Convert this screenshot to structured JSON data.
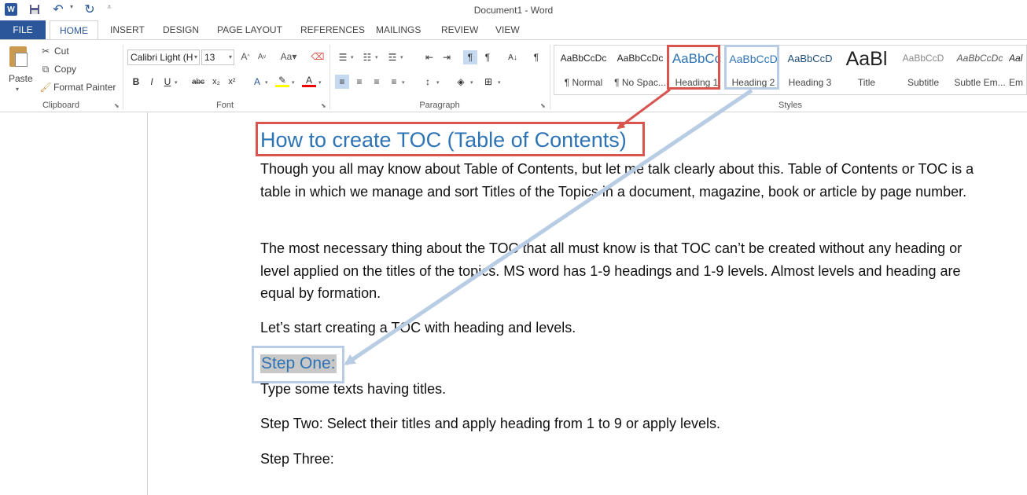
{
  "window": {
    "title": "Document1 - Word"
  },
  "quick_access": {
    "word_logo": "W"
  },
  "tabs": [
    "FILE",
    "HOME",
    "INSERT",
    "DESIGN",
    "PAGE LAYOUT",
    "REFERENCES",
    "MAILINGS",
    "REVIEW",
    "VIEW"
  ],
  "clipboard": {
    "paste": "Paste",
    "cut": "Cut",
    "copy": "Copy",
    "format_painter": "Format Painter",
    "label": "Clipboard"
  },
  "font": {
    "name": "Calibri Light (H",
    "size": "13",
    "label": "Font"
  },
  "paragraph": {
    "label": "Paragraph"
  },
  "styles": {
    "label": "Styles",
    "items": [
      {
        "preview": "AaBbCcDc",
        "name": "¶ Normal"
      },
      {
        "preview": "AaBbCcDc",
        "name": "¶ No Spac..."
      },
      {
        "preview": "AaBbCc",
        "name": "Heading 1"
      },
      {
        "preview": "AaBbCcD",
        "name": "Heading 2"
      },
      {
        "preview": "AaBbCcD",
        "name": "Heading 3"
      },
      {
        "preview": "AaBl",
        "name": "Title"
      },
      {
        "preview": "AaBbCcD",
        "name": "Subtitle"
      },
      {
        "preview": "AaBbCcDc",
        "name": "Subtle Em..."
      },
      {
        "preview": "Aal",
        "name": "Em"
      }
    ]
  },
  "document": {
    "heading1": "How to create TOC (Table of Contents)",
    "para1": "Though you all may know about Table of Contents, but let me talk clearly about this. Table of Contents or TOC is a table in which we manage and sort Titles of the Topics in a document, magazine, book or article by page number.",
    "para2": "The most necessary thing about the TOC that all must know is that TOC can’t be created without any heading or level applied on the titles of the topics. MS word has 1-9 headings and 1-9 levels. Almost levels and heading are equal by formation.",
    "para3": "Let’s start creating a TOC with heading and levels.",
    "heading2": "Step One:",
    "line1": " Type some texts having titles.",
    "line2": "Step Two: Select their titles and apply heading from 1 to 9 or apply levels.",
    "line3": "Step Three:"
  },
  "colors": {
    "accent": "#2b579a",
    "heading": "#2e74b5",
    "red_highlight": "#d9534f",
    "blue_highlight": "#b8cce4"
  }
}
